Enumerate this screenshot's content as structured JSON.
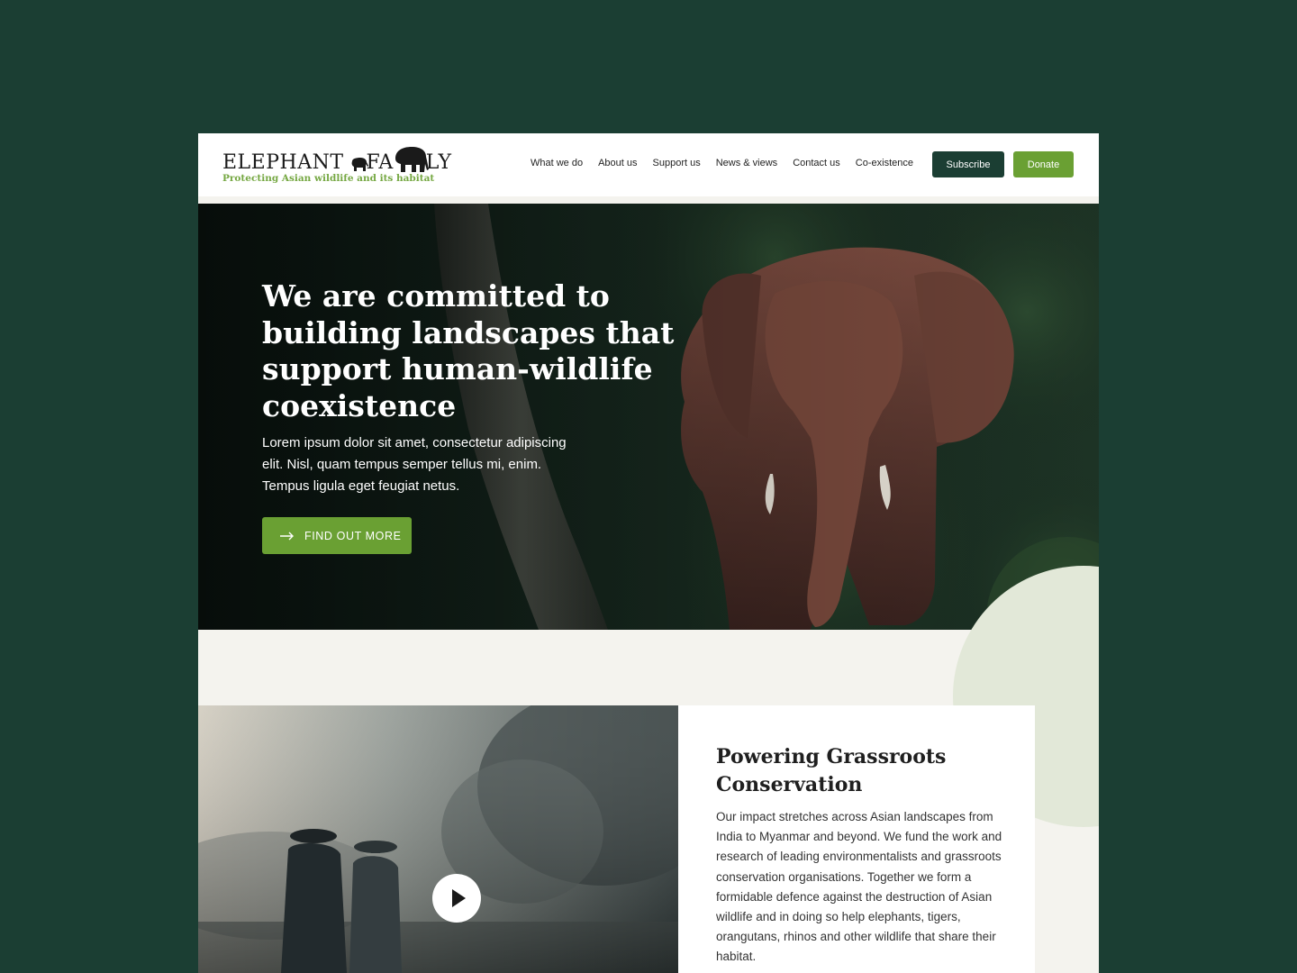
{
  "logo": {
    "word_part1": "ELEPHANT",
    "word_part2": "FA",
    "word_part3": "LY",
    "tagline": "Protecting Asian wildlife and its habitat"
  },
  "nav": {
    "items": [
      {
        "label": "What we do"
      },
      {
        "label": "About us"
      },
      {
        "label": "Support us"
      },
      {
        "label": "News & views"
      },
      {
        "label": "Contact us"
      },
      {
        "label": "Co-existence"
      }
    ],
    "subscribe_label": "Subscribe",
    "donate_label": "Donate"
  },
  "hero": {
    "title": "We are committed to building landscapes that support human-wildlife coexistence",
    "text": "Lorem ipsum dolor sit amet, consectetur adipiscing elit. Nisl, quam tempus semper tellus mi, enim. Tempus ligula eget feugiat netus.",
    "cta_label": "FIND OUT MORE",
    "cta_icon": "arrow-right-icon"
  },
  "section": {
    "title": "Powering Grassroots Conservation",
    "body": "Our impact stretches across Asian landscapes from India to Myanmar and beyond. We fund the work and research of leading environmentalists and grassroots conservation organisations. Together we form a formidable defence against the destruction of Asian wildlife and in doing so help elephants, tigers, orangutans, rhinos and other wildlife that share their habitat.",
    "video_icon": "play-icon"
  },
  "colors": {
    "page_bg": "#1b3e33",
    "brand_dark": "#1b3e33",
    "brand_green": "#6aa033",
    "tagline_green": "#76a843",
    "section_bg": "#f4f3ee"
  }
}
